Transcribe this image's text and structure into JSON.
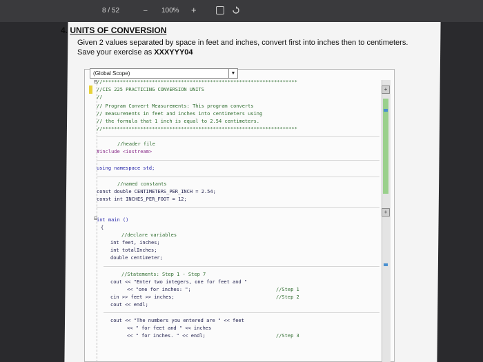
{
  "viewer": {
    "page_counter": "8 / 52",
    "zoom_minus": "–",
    "zoom": "100%",
    "zoom_plus": "+"
  },
  "document": {
    "number": "4.",
    "title": "UNITS OF CONVERSION",
    "instruction_1": "Given 2 values separated by space in feet and inches, convert first into inches then to centimeters.",
    "instruction_2_prefix": "Save your exercise as ",
    "instruction_2_name": "XXXYYY04"
  },
  "ide": {
    "scope_combo": "(Global Scope)",
    "scroll_plus": "+",
    "code": {
      "l1": "//*******************************************************************",
      "l2": "//CIS 225 PRACTICING CONVERSION UNITS",
      "l3": "//",
      "l4": "// Program Convert Measurements: This program converts",
      "l5": "// measurements in feet and inches into centimeters using",
      "l6": "// the formula that 1 inch is equal to 2.54 centimeters.",
      "l7": "//*******************************************************************",
      "l8": "//header file",
      "l9": "#include <iostream>",
      "l10": "using namespace std;",
      "l11": "//named constants",
      "l12": "const double CENTIMETERS_PER_INCH = 2.54;",
      "l13": "const int INCHES_PER_FOOT = 12;",
      "l14": "int main ()",
      "l15": "{",
      "l16": "//declare variables",
      "l17": "int feet, inches;",
      "l18": "int totalInches;",
      "l19": "double centimeter;",
      "l20": "//Statements: Step 1 - Step 7",
      "l21": "cout << \"Enter two integers, one for feet and \"",
      "l22": "<< \"one for inches: \";",
      "l23": "cin >> feet >> inches;",
      "l24": "cout << endl;",
      "l25": "cout << \"The numbers you entered are \" << feet",
      "l26": "<< \" for feet and \" << inches",
      "l27": "<< \" for inches. \" << endl;",
      "c1": "//Step 1",
      "c2": "//Step 2",
      "c3": "//Step 3"
    }
  }
}
